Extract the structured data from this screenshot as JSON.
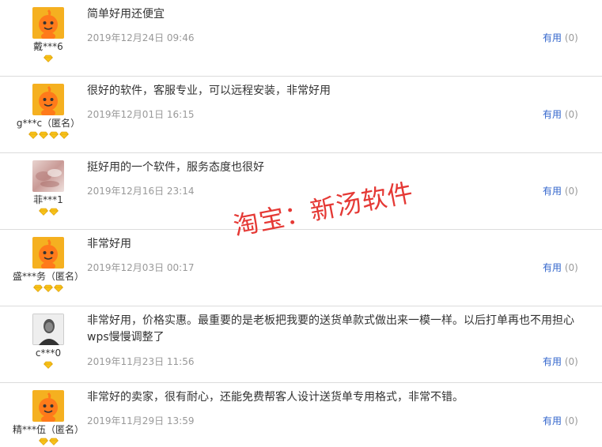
{
  "reviews": [
    {
      "avatar": "default-mascot",
      "username": "戴***6",
      "rank": 1,
      "content": "简单好用还便宜",
      "date": "2019年12月24日 09:46",
      "useful_label": "有用",
      "useful_count": "(0)"
    },
    {
      "avatar": "default-mascot",
      "username": "g***c（匿名）",
      "rank": 4,
      "content": "很好的软件，客服专业，可以远程安装，非常好用",
      "date": "2019年12月01日 16:15",
      "useful_label": "有用",
      "useful_count": "(0)"
    },
    {
      "avatar": "photo",
      "username": "菲***1",
      "rank": 2,
      "content": "挺好用的一个软件，服务态度也很好",
      "date": "2019年12月16日 23:14",
      "useful_label": "有用",
      "useful_count": "(0)"
    },
    {
      "avatar": "default-mascot",
      "username": "盛***务（匿名）",
      "rank": 3,
      "content": "非常好用",
      "date": "2019年12月03日 00:17",
      "useful_label": "有用",
      "useful_count": "(0)"
    },
    {
      "avatar": "person-photo",
      "username": "c***0",
      "rank": 1,
      "content": "非常好用，价格实惠。最重要的是老板把我要的送货单款式做出来一模一样。以后打单再也不用担心wps慢慢调整了",
      "date": "2019年11月23日 11:56",
      "useful_label": "有用",
      "useful_count": "(0)"
    },
    {
      "avatar": "default-mascot",
      "username": "精***伍（匿名）",
      "rank": 2,
      "content": "非常好的卖家，很有耐心，还能免费帮客人设计送货单专用格式，非常不错。",
      "date": "2019年11月29日 13:59",
      "useful_label": "有用",
      "useful_count": "(0)"
    }
  ],
  "watermark": "淘宝：新汤软件",
  "colors": {
    "link": "#3366cc",
    "date": "#999999",
    "divider": "#dcdcdc",
    "watermark": "#e53935",
    "mascot_bg": "#f5b020",
    "mascot_body": "#ff7a1a",
    "diamond": "#f7c21b"
  }
}
